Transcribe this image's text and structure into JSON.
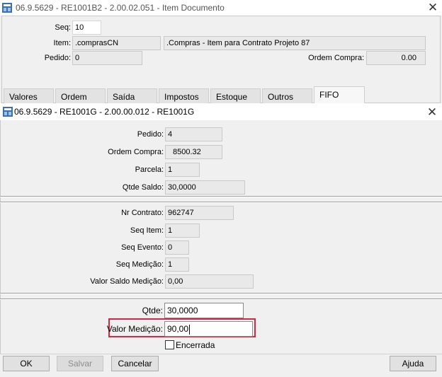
{
  "outer_window": {
    "title": "06.9.5629 - RE1001B2 - 2.00.02.051 - Item Documento",
    "seq_label": "Seq:",
    "seq_value": "10",
    "item_label": "Item:",
    "item_code": ".comprasCN",
    "item_description": ".Compras - Item para Contrato Projeto 87",
    "pedido_label": "Pedido:",
    "pedido_value": "0",
    "ordem_compra_label": "Ordem Compra:",
    "ordem_compra_value": "0.00",
    "tabs": [
      {
        "label": "Valores"
      },
      {
        "label": "Ordem"
      },
      {
        "label": "Saída"
      },
      {
        "label": "Impostos"
      },
      {
        "label": "Estoque"
      },
      {
        "label": "Outros"
      },
      {
        "label": "FIFO",
        "active": true
      }
    ]
  },
  "modal": {
    "title": "06.9.5629 - RE1001G - 2.00.00.012 - RE1001G",
    "section1": {
      "pedido_label": "Pedido:",
      "pedido_value": "4",
      "ordem_compra_label": "Ordem Compra:",
      "ordem_compra_value": "8500.32",
      "parcela_label": "Parcela:",
      "parcela_value": "1",
      "qtde_saldo_label": "Qtde Saldo:",
      "qtde_saldo_value": "30,0000"
    },
    "section2": {
      "nr_contrato_label": "Nr Contrato:",
      "nr_contrato_value": "962747",
      "seq_item_label": "Seq Item:",
      "seq_item_value": "1",
      "seq_evento_label": "Seq Evento:",
      "seq_evento_value": "0",
      "seq_medicao_label": "Seq Medição:",
      "seq_medicao_value": "1",
      "valor_saldo_medicao_label": "Valor Saldo Medição:",
      "valor_saldo_medicao_value": "0,00"
    },
    "section3": {
      "qtde_label": "Qtde:",
      "qtde_value": "30,0000",
      "valor_medicao_label": "Valor Medição:",
      "valor_medicao_value": "90,00",
      "encerrada_label": "Encerrada",
      "encerrada_checked": false
    },
    "buttons": {
      "ok": "OK",
      "salvar": "Salvar",
      "cancelar": "Cancelar",
      "ajuda": "Ajuda"
    }
  },
  "colors": {
    "highlight": "#d7263d",
    "window_bg": "#f0f0f0"
  }
}
